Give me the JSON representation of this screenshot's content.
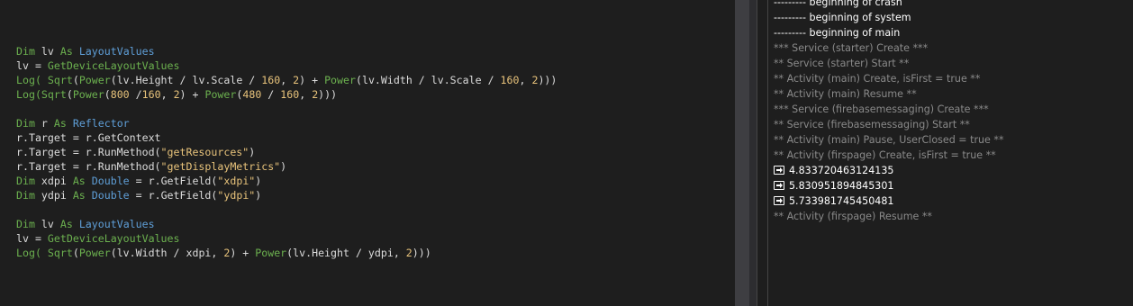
{
  "editor": {
    "lines": [
      [
        {
          "t": "Dim ",
          "c": "kw"
        },
        {
          "t": "lv ",
          "c": "plain"
        },
        {
          "t": "As ",
          "c": "kw"
        },
        {
          "t": "LayoutValues",
          "c": "ty"
        }
      ],
      [
        {
          "t": "lv = ",
          "c": "plain"
        },
        {
          "t": "GetDeviceLayoutValues",
          "c": "fn"
        }
      ],
      [
        {
          "t": "Log( ",
          "c": "fn"
        },
        {
          "t": "Sqrt",
          "c": "fn"
        },
        {
          "t": "(",
          "c": "plain"
        },
        {
          "t": "Power",
          "c": "fn"
        },
        {
          "t": "(lv.Height / lv.Scale / ",
          "c": "plain"
        },
        {
          "t": "160",
          "c": "num"
        },
        {
          "t": ", ",
          "c": "plain"
        },
        {
          "t": "2",
          "c": "num"
        },
        {
          "t": ") + ",
          "c": "plain"
        },
        {
          "t": "Power",
          "c": "fn"
        },
        {
          "t": "(lv.Width / lv.Scale / ",
          "c": "plain"
        },
        {
          "t": "160",
          "c": "num"
        },
        {
          "t": ", ",
          "c": "plain"
        },
        {
          "t": "2",
          "c": "num"
        },
        {
          "t": ")))",
          "c": "plain"
        }
      ],
      [
        {
          "t": "Log(",
          "c": "fn"
        },
        {
          "t": "Sqrt",
          "c": "fn"
        },
        {
          "t": "(",
          "c": "plain"
        },
        {
          "t": "Power",
          "c": "fn"
        },
        {
          "t": "(",
          "c": "plain"
        },
        {
          "t": "800",
          "c": "num"
        },
        {
          "t": " /",
          "c": "plain"
        },
        {
          "t": "160",
          "c": "num"
        },
        {
          "t": ", ",
          "c": "plain"
        },
        {
          "t": "2",
          "c": "num"
        },
        {
          "t": ") + ",
          "c": "plain"
        },
        {
          "t": "Power",
          "c": "fn"
        },
        {
          "t": "(",
          "c": "plain"
        },
        {
          "t": "480",
          "c": "num"
        },
        {
          "t": " / ",
          "c": "plain"
        },
        {
          "t": "160",
          "c": "num"
        },
        {
          "t": ", ",
          "c": "plain"
        },
        {
          "t": "2",
          "c": "num"
        },
        {
          "t": ")))",
          "c": "plain"
        }
      ],
      [],
      [
        {
          "t": "Dim ",
          "c": "kw"
        },
        {
          "t": "r ",
          "c": "plain"
        },
        {
          "t": "As ",
          "c": "kw"
        },
        {
          "t": "Reflector",
          "c": "ty"
        }
      ],
      [
        {
          "t": "r.Target = r.GetContext",
          "c": "plain"
        }
      ],
      [
        {
          "t": "r.Target = r.RunMethod(",
          "c": "plain"
        },
        {
          "t": "\"getResources\"",
          "c": "str"
        },
        {
          "t": ")",
          "c": "plain"
        }
      ],
      [
        {
          "t": "r.Target = r.RunMethod(",
          "c": "plain"
        },
        {
          "t": "\"getDisplayMetrics\"",
          "c": "str"
        },
        {
          "t": ")",
          "c": "plain"
        }
      ],
      [
        {
          "t": "Dim ",
          "c": "kw"
        },
        {
          "t": "xdpi ",
          "c": "plain"
        },
        {
          "t": "As ",
          "c": "kw"
        },
        {
          "t": "Double",
          "c": "ty"
        },
        {
          "t": " = r.GetField(",
          "c": "plain"
        },
        {
          "t": "\"xdpi\"",
          "c": "str"
        },
        {
          "t": ")",
          "c": "plain"
        }
      ],
      [
        {
          "t": "Dim ",
          "c": "kw"
        },
        {
          "t": "ydpi ",
          "c": "plain"
        },
        {
          "t": "As ",
          "c": "kw"
        },
        {
          "t": "Double",
          "c": "ty"
        },
        {
          "t": " = r.GetField(",
          "c": "plain"
        },
        {
          "t": "\"ydpi\"",
          "c": "str"
        },
        {
          "t": ")",
          "c": "plain"
        }
      ],
      [],
      [
        {
          "t": "Dim ",
          "c": "kw"
        },
        {
          "t": "lv ",
          "c": "plain"
        },
        {
          "t": "As ",
          "c": "kw"
        },
        {
          "t": "LayoutValues",
          "c": "ty"
        }
      ],
      [
        {
          "t": "lv = ",
          "c": "plain"
        },
        {
          "t": "GetDeviceLayoutValues",
          "c": "fn"
        }
      ],
      [
        {
          "t": "Log( ",
          "c": "fn"
        },
        {
          "t": "Sqrt",
          "c": "fn"
        },
        {
          "t": "(",
          "c": "plain"
        },
        {
          "t": "Power",
          "c": "fn"
        },
        {
          "t": "(lv.Width / xdpi, ",
          "c": "plain"
        },
        {
          "t": "2",
          "c": "num"
        },
        {
          "t": ") + ",
          "c": "plain"
        },
        {
          "t": "Power",
          "c": "fn"
        },
        {
          "t": "(lv.Height / ydpi, ",
          "c": "plain"
        },
        {
          "t": "2",
          "c": "num"
        },
        {
          "t": ")))",
          "c": "plain"
        }
      ]
    ]
  },
  "log": {
    "entries": [
      {
        "text": "--------- beginning of crash",
        "kind": "sys"
      },
      {
        "text": "--------- beginning of system",
        "kind": "sys"
      },
      {
        "text": "--------- beginning of main",
        "kind": "sys"
      },
      {
        "text": "*** Service (starter) Create ***",
        "kind": "svc"
      },
      {
        "text": "** Service (starter) Start **",
        "kind": "svc"
      },
      {
        "text": "** Activity (main) Create, isFirst = true **",
        "kind": "svc"
      },
      {
        "text": "** Activity (main) Resume **",
        "kind": "svc"
      },
      {
        "text": "*** Service (firebasemessaging) Create ***",
        "kind": "svc"
      },
      {
        "text": "** Service (firebasemessaging) Start **",
        "kind": "svc"
      },
      {
        "text": "** Activity (main) Pause, UserClosed = true **",
        "kind": "svc"
      },
      {
        "text": "** Activity (firspage) Create, isFirst = true **",
        "kind": "svc"
      },
      {
        "text": "4.833720463124135",
        "kind": "res"
      },
      {
        "text": "5.830951894845301",
        "kind": "res"
      },
      {
        "text": "5.733981745450481",
        "kind": "res"
      },
      {
        "text": "** Activity (firspage) Resume **",
        "kind": "svc"
      }
    ]
  },
  "colors": {
    "background": "#1e1e1e",
    "keyword": "#6cb14f",
    "type": "#5f9fd8",
    "number_string": "#e8c37b",
    "plain": "#dcdcdc",
    "log_muted": "#8a8a8a",
    "log_bright": "#ffffff"
  }
}
